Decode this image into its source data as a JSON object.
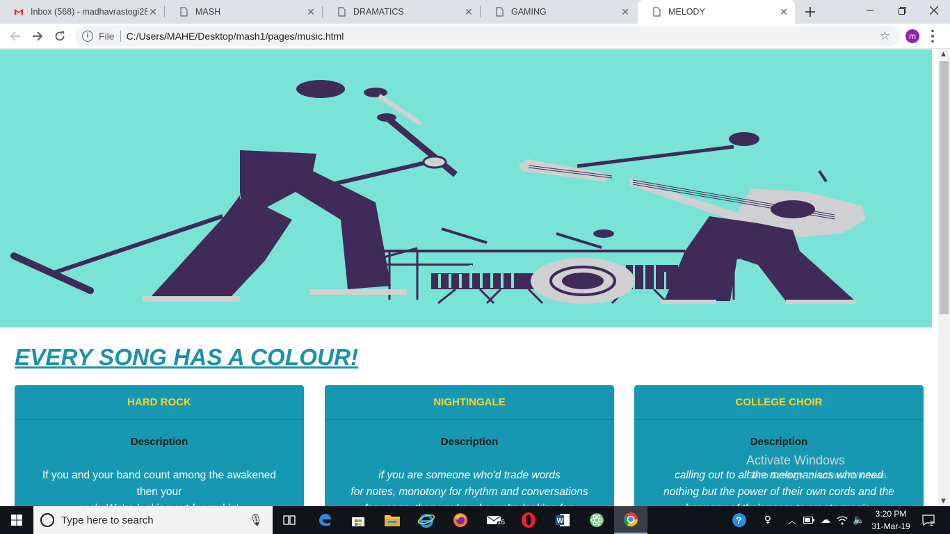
{
  "browser": {
    "tabs": [
      {
        "title": "Inbox (568) - madhavrastogi28",
        "icon": "gmail-icon"
      },
      {
        "title": "MASH",
        "icon": "page-icon"
      },
      {
        "title": "DRAMATICS",
        "icon": "page-icon"
      },
      {
        "title": "GAMING",
        "icon": "page-icon"
      },
      {
        "title": "MELODY",
        "icon": "page-icon",
        "active": true
      }
    ],
    "address": {
      "scheme": "File",
      "url": "C:/Users/MAHE/Desktop/mash1/pages/music.html"
    },
    "profile_initial": "m"
  },
  "page": {
    "headline": "EVERY SONG HAS A COLOUR!",
    "cards": [
      {
        "title": "HARD ROCK",
        "label": "Description",
        "lines": [
          "If you and your band count among the awakened",
          "then your",
          "...rock. We're looking out for rockin'..."
        ]
      },
      {
        "title": "NIGHTINGALE",
        "label": "Description",
        "lines": [
          "if you are someone who'd trade words",
          "for notes, monotony for rhythm and conversations",
          "for songs, then you're who we're looking for."
        ]
      },
      {
        "title": "COLLEGE CHOIR",
        "label": "Description",
        "lines": [
          "calling out to all the melomaniacs who need",
          "nothing but the power of their own cords and the",
          "harmony of their peers to create magic."
        ]
      }
    ],
    "colors": {
      "hero_bg": "#79e3d6",
      "card_bg": "#1798b2",
      "card_title": "#f7d32a",
      "headline": "#1b92aa",
      "figure": "#402a57"
    }
  },
  "os": {
    "watermark_title": "Activate Windows",
    "watermark_sub": "Go to Settings to activate Windows.",
    "search_placeholder": "Type here to search",
    "clock_time": "3:20 PM",
    "clock_date": "31-Mar-19",
    "mail_badge": "16",
    "notification_count": "2"
  }
}
